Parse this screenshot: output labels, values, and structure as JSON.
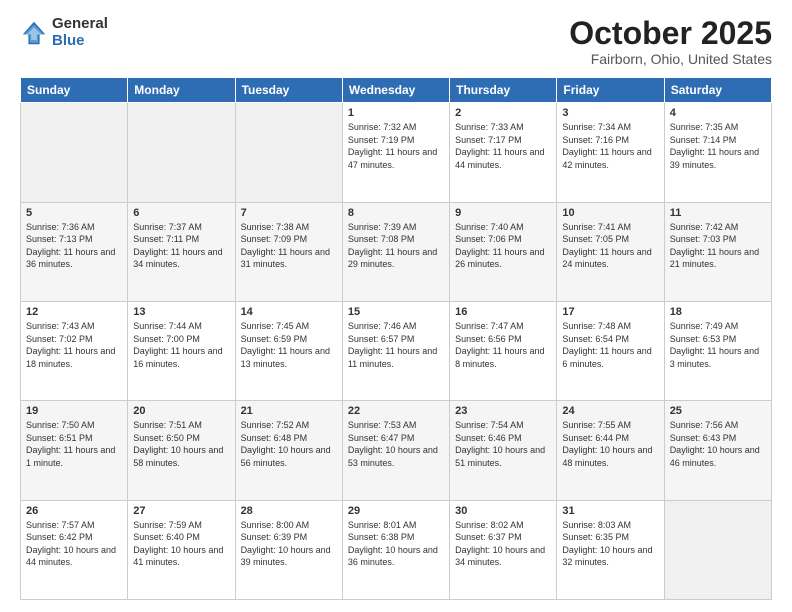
{
  "header": {
    "logo_general": "General",
    "logo_blue": "Blue",
    "month_title": "October 2025",
    "location": "Fairborn, Ohio, United States"
  },
  "days_of_week": [
    "Sunday",
    "Monday",
    "Tuesday",
    "Wednesday",
    "Thursday",
    "Friday",
    "Saturday"
  ],
  "weeks": [
    [
      {
        "day": "",
        "sunrise": "",
        "sunset": "",
        "daylight": ""
      },
      {
        "day": "",
        "sunrise": "",
        "sunset": "",
        "daylight": ""
      },
      {
        "day": "",
        "sunrise": "",
        "sunset": "",
        "daylight": ""
      },
      {
        "day": "1",
        "sunrise": "Sunrise: 7:32 AM",
        "sunset": "Sunset: 7:19 PM",
        "daylight": "Daylight: 11 hours and 47 minutes."
      },
      {
        "day": "2",
        "sunrise": "Sunrise: 7:33 AM",
        "sunset": "Sunset: 7:17 PM",
        "daylight": "Daylight: 11 hours and 44 minutes."
      },
      {
        "day": "3",
        "sunrise": "Sunrise: 7:34 AM",
        "sunset": "Sunset: 7:16 PM",
        "daylight": "Daylight: 11 hours and 42 minutes."
      },
      {
        "day": "4",
        "sunrise": "Sunrise: 7:35 AM",
        "sunset": "Sunset: 7:14 PM",
        "daylight": "Daylight: 11 hours and 39 minutes."
      }
    ],
    [
      {
        "day": "5",
        "sunrise": "Sunrise: 7:36 AM",
        "sunset": "Sunset: 7:13 PM",
        "daylight": "Daylight: 11 hours and 36 minutes."
      },
      {
        "day": "6",
        "sunrise": "Sunrise: 7:37 AM",
        "sunset": "Sunset: 7:11 PM",
        "daylight": "Daylight: 11 hours and 34 minutes."
      },
      {
        "day": "7",
        "sunrise": "Sunrise: 7:38 AM",
        "sunset": "Sunset: 7:09 PM",
        "daylight": "Daylight: 11 hours and 31 minutes."
      },
      {
        "day": "8",
        "sunrise": "Sunrise: 7:39 AM",
        "sunset": "Sunset: 7:08 PM",
        "daylight": "Daylight: 11 hours and 29 minutes."
      },
      {
        "day": "9",
        "sunrise": "Sunrise: 7:40 AM",
        "sunset": "Sunset: 7:06 PM",
        "daylight": "Daylight: 11 hours and 26 minutes."
      },
      {
        "day": "10",
        "sunrise": "Sunrise: 7:41 AM",
        "sunset": "Sunset: 7:05 PM",
        "daylight": "Daylight: 11 hours and 24 minutes."
      },
      {
        "day": "11",
        "sunrise": "Sunrise: 7:42 AM",
        "sunset": "Sunset: 7:03 PM",
        "daylight": "Daylight: 11 hours and 21 minutes."
      }
    ],
    [
      {
        "day": "12",
        "sunrise": "Sunrise: 7:43 AM",
        "sunset": "Sunset: 7:02 PM",
        "daylight": "Daylight: 11 hours and 18 minutes."
      },
      {
        "day": "13",
        "sunrise": "Sunrise: 7:44 AM",
        "sunset": "Sunset: 7:00 PM",
        "daylight": "Daylight: 11 hours and 16 minutes."
      },
      {
        "day": "14",
        "sunrise": "Sunrise: 7:45 AM",
        "sunset": "Sunset: 6:59 PM",
        "daylight": "Daylight: 11 hours and 13 minutes."
      },
      {
        "day": "15",
        "sunrise": "Sunrise: 7:46 AM",
        "sunset": "Sunset: 6:57 PM",
        "daylight": "Daylight: 11 hours and 11 minutes."
      },
      {
        "day": "16",
        "sunrise": "Sunrise: 7:47 AM",
        "sunset": "Sunset: 6:56 PM",
        "daylight": "Daylight: 11 hours and 8 minutes."
      },
      {
        "day": "17",
        "sunrise": "Sunrise: 7:48 AM",
        "sunset": "Sunset: 6:54 PM",
        "daylight": "Daylight: 11 hours and 6 minutes."
      },
      {
        "day": "18",
        "sunrise": "Sunrise: 7:49 AM",
        "sunset": "Sunset: 6:53 PM",
        "daylight": "Daylight: 11 hours and 3 minutes."
      }
    ],
    [
      {
        "day": "19",
        "sunrise": "Sunrise: 7:50 AM",
        "sunset": "Sunset: 6:51 PM",
        "daylight": "Daylight: 11 hours and 1 minute."
      },
      {
        "day": "20",
        "sunrise": "Sunrise: 7:51 AM",
        "sunset": "Sunset: 6:50 PM",
        "daylight": "Daylight: 10 hours and 58 minutes."
      },
      {
        "day": "21",
        "sunrise": "Sunrise: 7:52 AM",
        "sunset": "Sunset: 6:48 PM",
        "daylight": "Daylight: 10 hours and 56 minutes."
      },
      {
        "day": "22",
        "sunrise": "Sunrise: 7:53 AM",
        "sunset": "Sunset: 6:47 PM",
        "daylight": "Daylight: 10 hours and 53 minutes."
      },
      {
        "day": "23",
        "sunrise": "Sunrise: 7:54 AM",
        "sunset": "Sunset: 6:46 PM",
        "daylight": "Daylight: 10 hours and 51 minutes."
      },
      {
        "day": "24",
        "sunrise": "Sunrise: 7:55 AM",
        "sunset": "Sunset: 6:44 PM",
        "daylight": "Daylight: 10 hours and 48 minutes."
      },
      {
        "day": "25",
        "sunrise": "Sunrise: 7:56 AM",
        "sunset": "Sunset: 6:43 PM",
        "daylight": "Daylight: 10 hours and 46 minutes."
      }
    ],
    [
      {
        "day": "26",
        "sunrise": "Sunrise: 7:57 AM",
        "sunset": "Sunset: 6:42 PM",
        "daylight": "Daylight: 10 hours and 44 minutes."
      },
      {
        "day": "27",
        "sunrise": "Sunrise: 7:59 AM",
        "sunset": "Sunset: 6:40 PM",
        "daylight": "Daylight: 10 hours and 41 minutes."
      },
      {
        "day": "28",
        "sunrise": "Sunrise: 8:00 AM",
        "sunset": "Sunset: 6:39 PM",
        "daylight": "Daylight: 10 hours and 39 minutes."
      },
      {
        "day": "29",
        "sunrise": "Sunrise: 8:01 AM",
        "sunset": "Sunset: 6:38 PM",
        "daylight": "Daylight: 10 hours and 36 minutes."
      },
      {
        "day": "30",
        "sunrise": "Sunrise: 8:02 AM",
        "sunset": "Sunset: 6:37 PM",
        "daylight": "Daylight: 10 hours and 34 minutes."
      },
      {
        "day": "31",
        "sunrise": "Sunrise: 8:03 AM",
        "sunset": "Sunset: 6:35 PM",
        "daylight": "Daylight: 10 hours and 32 minutes."
      },
      {
        "day": "",
        "sunrise": "",
        "sunset": "",
        "daylight": ""
      }
    ]
  ]
}
